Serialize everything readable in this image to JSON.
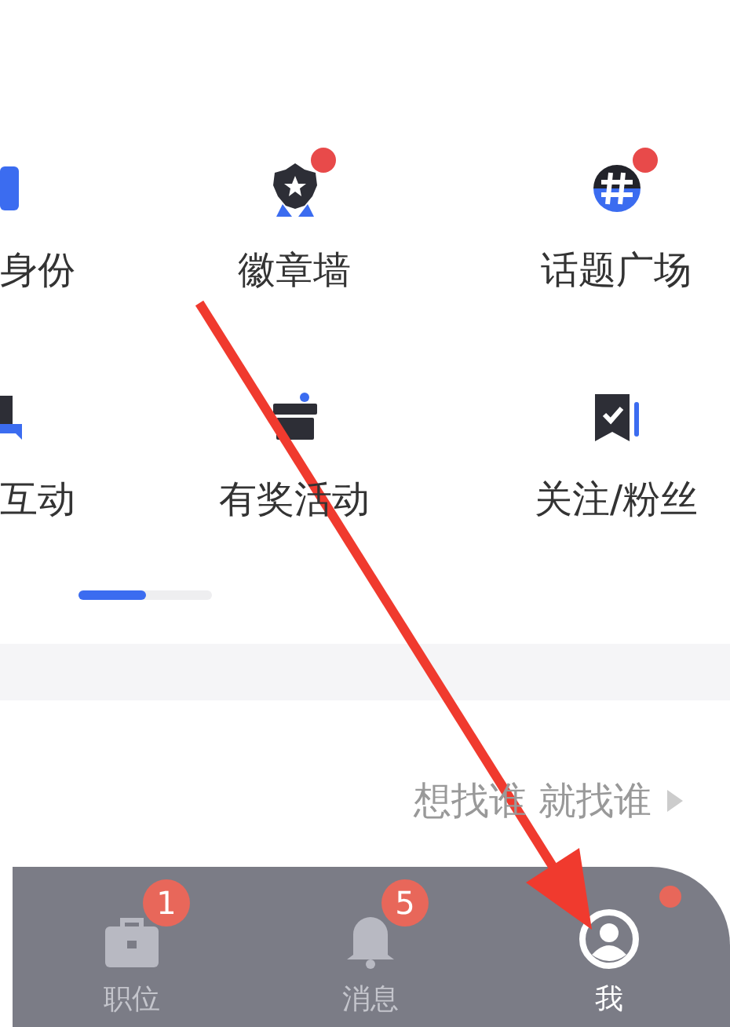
{
  "grid": [
    {
      "label": "身份",
      "kind": "id",
      "badge": false
    },
    {
      "label": "徽章墙",
      "kind": "medal",
      "badge": true
    },
    {
      "label": "话题广场",
      "kind": "hash",
      "badge": true
    },
    {
      "label": "互动",
      "kind": "chat",
      "badge": false
    },
    {
      "label": "有奖活动",
      "kind": "gift",
      "badge": false
    },
    {
      "label": "关注/粉丝",
      "kind": "follow",
      "badge": false
    }
  ],
  "pager": {
    "level": 0.5
  },
  "hint": {
    "text": "想找谁 就找谁"
  },
  "tab_bar": [
    {
      "label": "职位",
      "kind": "briefcase",
      "badge": "1",
      "dot": false,
      "selected": false
    },
    {
      "label": "消息",
      "kind": "bell",
      "badge": "5",
      "dot": false,
      "selected": false
    },
    {
      "label": "我",
      "kind": "person",
      "dot": true,
      "selected": true
    }
  ]
}
